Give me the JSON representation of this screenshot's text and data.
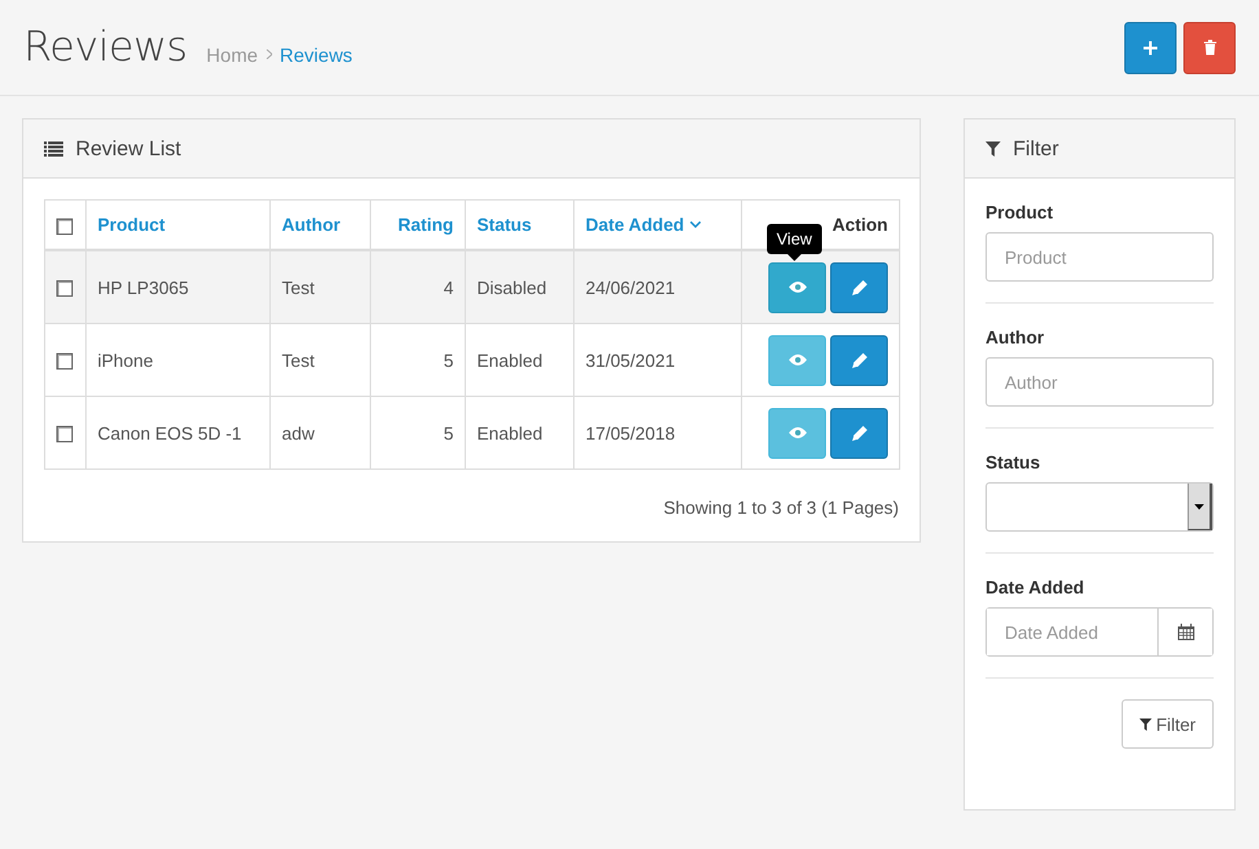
{
  "header": {
    "title": "Reviews",
    "breadcrumb": [
      {
        "label": "Home",
        "current": false
      },
      {
        "label": "Reviews",
        "current": true
      }
    ]
  },
  "review_list": {
    "title": "Review List",
    "select_all": {
      "checked": false
    },
    "columns": [
      {
        "label": "Product",
        "kind": "link",
        "sorted": false
      },
      {
        "label": "Author",
        "kind": "link",
        "sorted": false
      },
      {
        "label": "Rating",
        "kind": "number",
        "sorted": false
      },
      {
        "label": "Status",
        "kind": "link",
        "sorted": false
      },
      {
        "label": "Date Added",
        "kind": "link",
        "sorted": true
      },
      {
        "label": "Action",
        "kind": "action",
        "sorted": false
      }
    ],
    "rows": [
      {
        "checked": false,
        "highlighted": true,
        "cells": [
          "HP LP3065",
          "Test",
          "4",
          "Disabled",
          "24/06/2021"
        ],
        "view_tooltip": "View"
      },
      {
        "checked": false,
        "highlighted": false,
        "cells": [
          "iPhone",
          "Test",
          "5",
          "Enabled",
          "31/05/2021"
        ]
      },
      {
        "checked": false,
        "highlighted": false,
        "cells": [
          "Canon EOS 5D -1",
          "adw",
          "5",
          "Enabled",
          "17/05/2018"
        ]
      }
    ],
    "pagination_text": "Showing 1 to 3 of 3 (1 Pages)"
  },
  "filter": {
    "title": "Filter",
    "fields": [
      {
        "kind": "text",
        "label": "Product",
        "placeholder": "Product"
      },
      {
        "kind": "text",
        "label": "Author",
        "placeholder": "Author"
      },
      {
        "kind": "select",
        "label": "Status"
      },
      {
        "kind": "date",
        "label": "Date Added",
        "placeholder": "Date Added"
      }
    ],
    "button": "Filter"
  }
}
